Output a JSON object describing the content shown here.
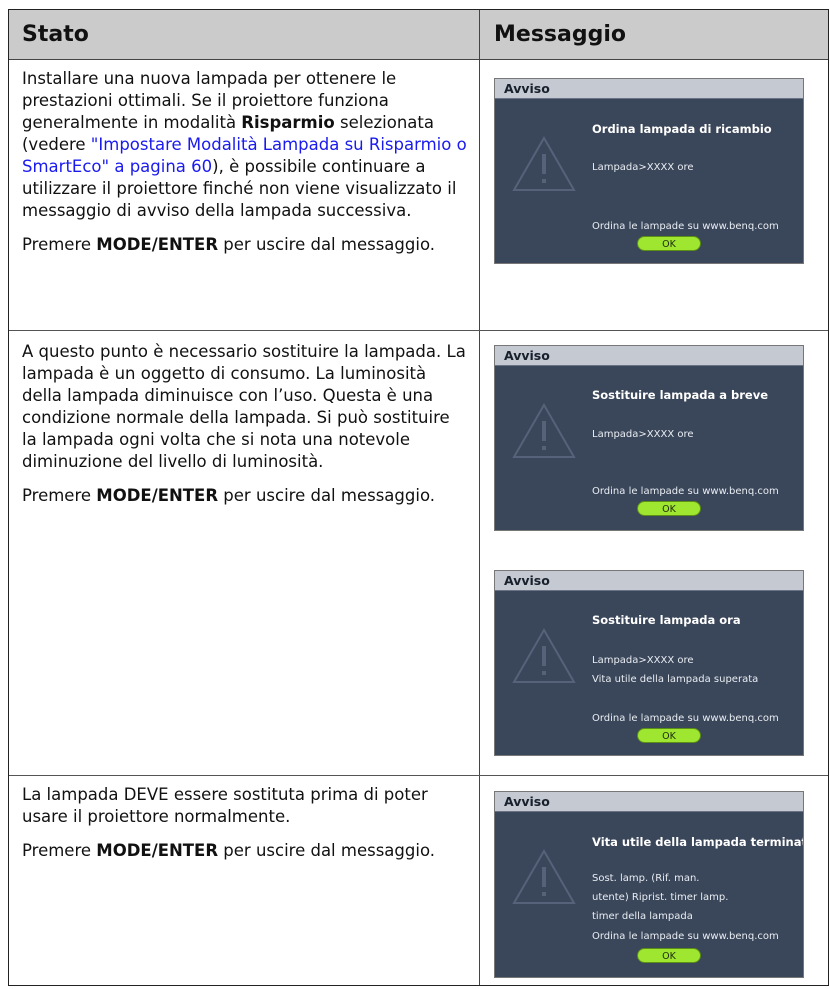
{
  "header": {
    "col1": "Stato",
    "col2": "Messaggio"
  },
  "rows": [
    {
      "text": {
        "p1_a": "Installare una nuova lampada per ottenere le prestazioni ottimali. Se il proiettore funziona generalmente in modalità ",
        "p1_bold": "Risparmio",
        "p1_b": " selezionata (vedere ",
        "p1_link": "\"Impostare Modalità Lampada su Risparmio o SmartEco\" a pagina 60",
        "p1_c": "), è possibile continuare a utilizzare il proiettore finché non viene visualizzato il messaggio di avviso della lampada successiva.",
        "p2_a": "Premere ",
        "p2_bold": "MODE/ENTER",
        "p2_b": " per uscire dal messaggio."
      },
      "messages": [
        {
          "title": "Avviso",
          "heading": "Ordina lampada di ricambio",
          "line1": "Lampada>XXXX ore",
          "order": "Ordina le lampade su www.benq.com",
          "ok": "OK"
        }
      ]
    },
    {
      "text": {
        "p1": "A questo punto è necessario sostituire la lampada. La lampada è un oggetto di consumo. La luminosità della lampada diminuisce con l’uso. Questa è una condizione normale della lampada. Si può sostituire la lampada ogni volta che si nota una notevole diminuzione del livello di luminosità.",
        "p2_a": "Premere ",
        "p2_bold": "MODE/ENTER",
        "p2_b": " per uscire dal messaggio."
      },
      "messages": [
        {
          "title": "Avviso",
          "heading": "Sostituire lampada a breve",
          "line1": "Lampada>XXXX ore",
          "order": "Ordina le lampade su www.benq.com",
          "ok": "OK"
        },
        {
          "title": "Avviso",
          "heading": "Sostituire lampada ora",
          "line1": "Lampada>XXXX ore",
          "line2": "Vita utile della lampada superata",
          "order": "Ordina le lampade su www.benq.com",
          "ok": "OK"
        }
      ]
    },
    {
      "text": {
        "p1": "La lampada DEVE essere sostituta prima di poter usare il proiettore normalmente.",
        "p2_a": "Premere ",
        "p2_bold": "MODE/ENTER",
        "p2_b": " per uscire dal messaggio."
      },
      "messages": [
        {
          "title": "Avviso",
          "heading": "Vita utile della lampada terminata",
          "line1": "Sost. lamp. (Rif. man.",
          "line2": "utente) Riprist. timer lamp.",
          "line3": "timer della lampada",
          "order": "Ordina le lampade su www.benq.com",
          "ok": "OK"
        }
      ]
    }
  ],
  "colors": {
    "header_bg": "#cbcbcb",
    "window_bg": "#3a4659",
    "window_title_bg": "#c4c9d2",
    "ok_button": "#9ee62f",
    "link": "#1a1aee"
  }
}
